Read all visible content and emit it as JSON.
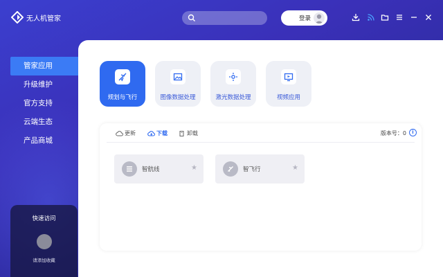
{
  "app": {
    "title": "无人机管家",
    "accent": "#3b7bf5",
    "brand_bg": "#3a30b8"
  },
  "header": {
    "search": {
      "placeholder": "",
      "icon": "search-icon"
    },
    "login": {
      "label": "登录",
      "avatar_icon": "avatar-icon"
    },
    "controls": [
      "download-icon",
      "rss-icon",
      "folder-icon",
      "menu-icon",
      "minimize-icon",
      "close-icon"
    ]
  },
  "sidebar": {
    "items": [
      {
        "label": "管家应用",
        "active": true
      },
      {
        "label": "升级维护",
        "active": false
      },
      {
        "label": "官方支持",
        "active": false
      },
      {
        "label": "云端生态",
        "active": false
      },
      {
        "label": "产品商城",
        "active": false
      }
    ],
    "quick": {
      "title": "快速访问",
      "hint": "请添加收藏"
    }
  },
  "main": {
    "tiles": [
      {
        "label": "规划与飞行",
        "icon": "plane-icon",
        "active": true
      },
      {
        "label": "图像数据处理",
        "icon": "image-icon",
        "active": false
      },
      {
        "label": "激光数据处理",
        "icon": "laser-icon",
        "active": false
      },
      {
        "label": "视频应用",
        "icon": "video-icon",
        "active": false
      }
    ],
    "tabs": [
      {
        "label": "更新",
        "icon": "cloud-refresh-icon",
        "active": false
      },
      {
        "label": "下载",
        "icon": "cloud-download-icon",
        "active": true
      },
      {
        "label": "卸载",
        "icon": "trash-icon",
        "active": false
      }
    ],
    "version_label": "版本号：",
    "version_value": "0",
    "info_glyph": "i",
    "apps": [
      {
        "label": "智航线",
        "icon": "list-icon",
        "favorite": false
      },
      {
        "label": "智飞行",
        "icon": "flight-icon",
        "favorite": false
      }
    ]
  }
}
